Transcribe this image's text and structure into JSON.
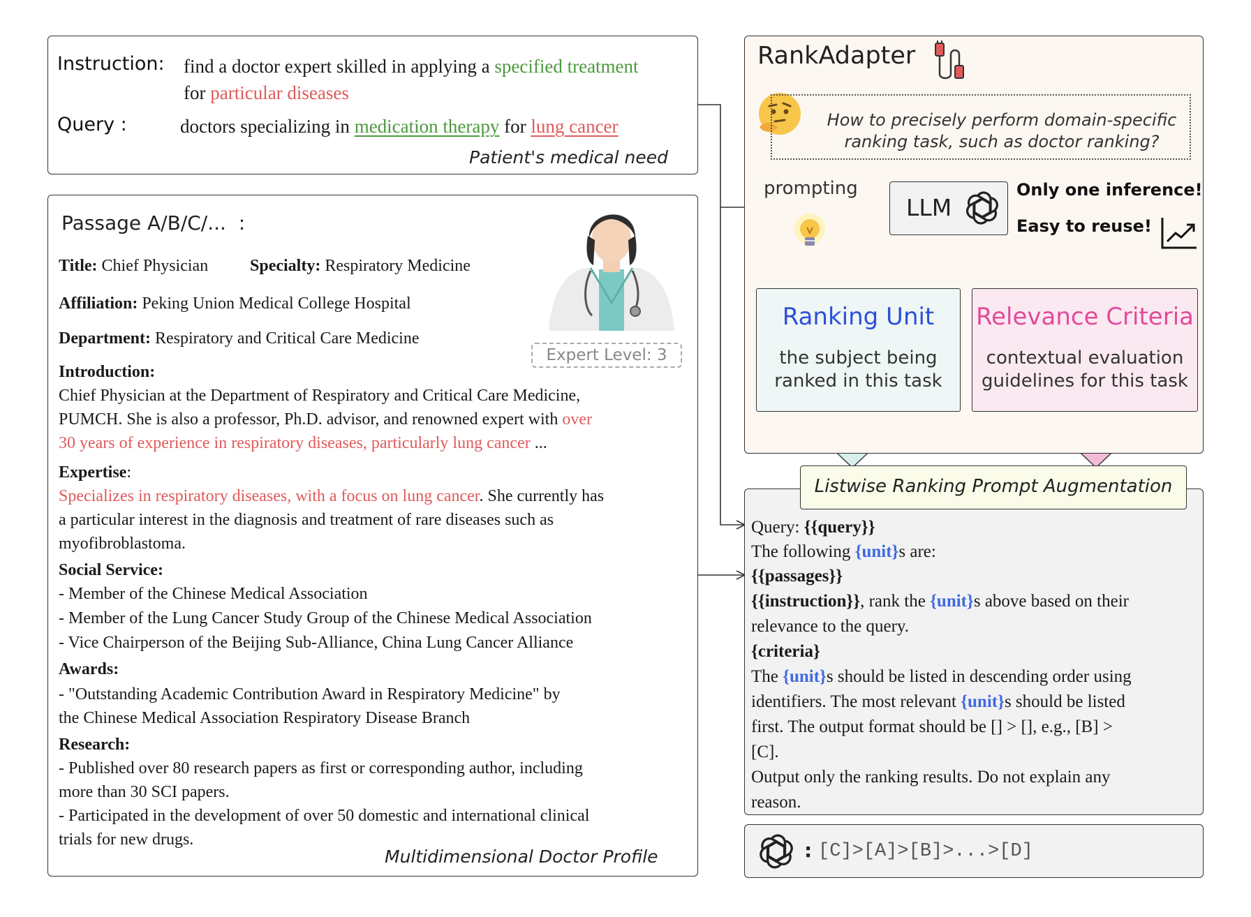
{
  "query_panel": {
    "instruction_label": "Instruction:",
    "instruction_pre": "find a doctor expert skilled in applying a",
    "instruction_green": "specified treatment",
    "instruction_for": "for",
    "instruction_red": "particular diseases",
    "query_label": "Query :",
    "query_pre": "doctors specializing in",
    "query_green": "medication therapy",
    "query_for": "for",
    "query_red": "lung cancer",
    "caption": "Patient's medical need"
  },
  "passage_panel": {
    "header": "Passage A/B/C/...  :",
    "title_label": "Title:",
    "title_value": "Chief Physician",
    "specialty_label": "Specialty:",
    "specialty_value": "Respiratory Medicine",
    "affiliation_label": "Affiliation:",
    "affiliation_value": "Peking Union Medical College Hospital",
    "department_label": "Department:",
    "department_value": "Respiratory and Critical Care Medicine",
    "expert_level": "Expert Level: 3",
    "introduction_label": "Introduction:",
    "intro_line1": "Chief Physician at the Department of Respiratory and Critical Care Medicine,",
    "intro_line2_pre": "PUMCH. She is also a professor, Ph.D. advisor, and renowned expert with",
    "intro_line2_red": "over",
    "intro_line3_red": "30 years of experience in respiratory diseases, particularly lung cancer",
    "intro_line3_post": "...",
    "expertise_label": "Expertise",
    "expertise_colon": ":",
    "expertise_line1_red": "Specializes in respiratory diseases, with a focus on lung cancer",
    "expertise_line1_post": ". She currently has",
    "expertise_line2": "a particular interest in the diagnosis and treatment of rare diseases such as",
    "expertise_line3": "myofibroblastoma.",
    "social_label": "Social Service:",
    "social_1": "- Member of the Chinese Medical Association",
    "social_2_dash": "-",
    "social_2_red": "Member of the Lung Cancer Study Group of the Chinese Medical Association",
    "social_3": "- Vice Chairperson of the Beijing Sub-Alliance, China Lung Cancer Alliance",
    "awards_label": "Awards:",
    "awards_1": "- \"Outstanding Academic Contribution Award in Respiratory Medicine\" by",
    "awards_2": "the Chinese Medical Association Respiratory Disease Branch",
    "research_label": "Research:",
    "research_1": "- Published over 80 research papers as first or corresponding author, including",
    "research_2": "more than 30 SCI papers.",
    "research_3_dash": "-",
    "research_3_green": "Participated in the development of over 50 domestic and international clinical",
    "research_4_green": "trials for new drugs.",
    "caption": "Multidimensional Doctor Profile"
  },
  "rankadapter": {
    "title": "RankAdapter",
    "question_line1": "How to precisely perform domain-specific",
    "question_line2": "ranking task, such as doctor ranking?",
    "prompting_label": "prompting",
    "llm_label": "LLM",
    "note_1": "Only one inference!",
    "note_2": "Easy to reuse!",
    "unit_title": "Ranking Unit",
    "unit_desc_1": "the subject being",
    "unit_desc_2": "ranked in this task",
    "criteria_title": "Relevance Criteria",
    "criteria_desc_1": "contextual evaluation",
    "criteria_desc_2": "guidelines for this task"
  },
  "prompt_panel": {
    "header": "Listwise Ranking Prompt Augmentation",
    "query_pre": "Query:",
    "query_var": "{{query}}",
    "following_pre": "The following",
    "unit_var": "{unit}",
    "following_post": "s are:",
    "passages_var": "{{passages}}",
    "instruction_var": "{{instruction}}",
    "rank_pre": ", rank the",
    "rank_post": "s above based on their",
    "relevance_line": "relevance to the query.",
    "criteria_var": "{criteria}",
    "listed_pre": "The",
    "listed_post": "s should be listed in descending order using",
    "ident_pre": "identifiers. The most relevant",
    "ident_post": "s should be listed",
    "first_line": "first. The output format should be [] > [], e.g., [B] >",
    "c_line": "[C].",
    "output_line1": "Output only the ranking results. Do not explain any",
    "output_line2": "reason."
  },
  "result": {
    "colon": ":",
    "ranking": "[C]>[A]>[B]>...>[D]"
  },
  "colors": {
    "green": "#4a9a3c",
    "red": "#e05a5a",
    "blue": "#4169e1",
    "pink": "#e24a9a",
    "unit_box": "#eef7f6",
    "criteria_box": "#fbe9f1",
    "rankadapter_bg": "#fdf7f2",
    "prompt_bg": "#f2f2f2"
  }
}
